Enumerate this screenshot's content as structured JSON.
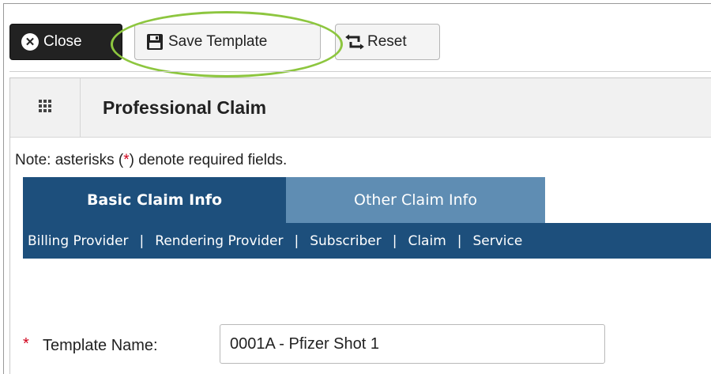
{
  "toolbar": {
    "close_label": "Close",
    "save_template_label": "Save Template",
    "reset_label": "Reset"
  },
  "panel": {
    "title": "Professional Claim"
  },
  "note": {
    "prefix": "Note: asterisks (",
    "asterisk": "*",
    "suffix": ") denote required fields."
  },
  "tabs": [
    {
      "label": "Basic Claim Info",
      "active": true
    },
    {
      "label": "Other Claim Info",
      "active": false
    }
  ],
  "subnav": {
    "items": [
      "Billing Provider",
      "Rendering Provider",
      "Subscriber",
      "Claim",
      "Service"
    ],
    "separator": "|"
  },
  "form": {
    "template_name": {
      "required_marker": "*",
      "label": "Template Name:",
      "value": "0001A - Pfizer Shot 1"
    }
  },
  "colors": {
    "tab_active": "#1d4f7c",
    "tab_inactive": "#5f8db3",
    "highlight": "#8dc63f",
    "required": "#d0021b"
  },
  "icons": {
    "close": "close-circle-icon",
    "save": "floppy-disk-icon",
    "reset": "reset-arrows-icon",
    "grid": "grid-icon"
  }
}
